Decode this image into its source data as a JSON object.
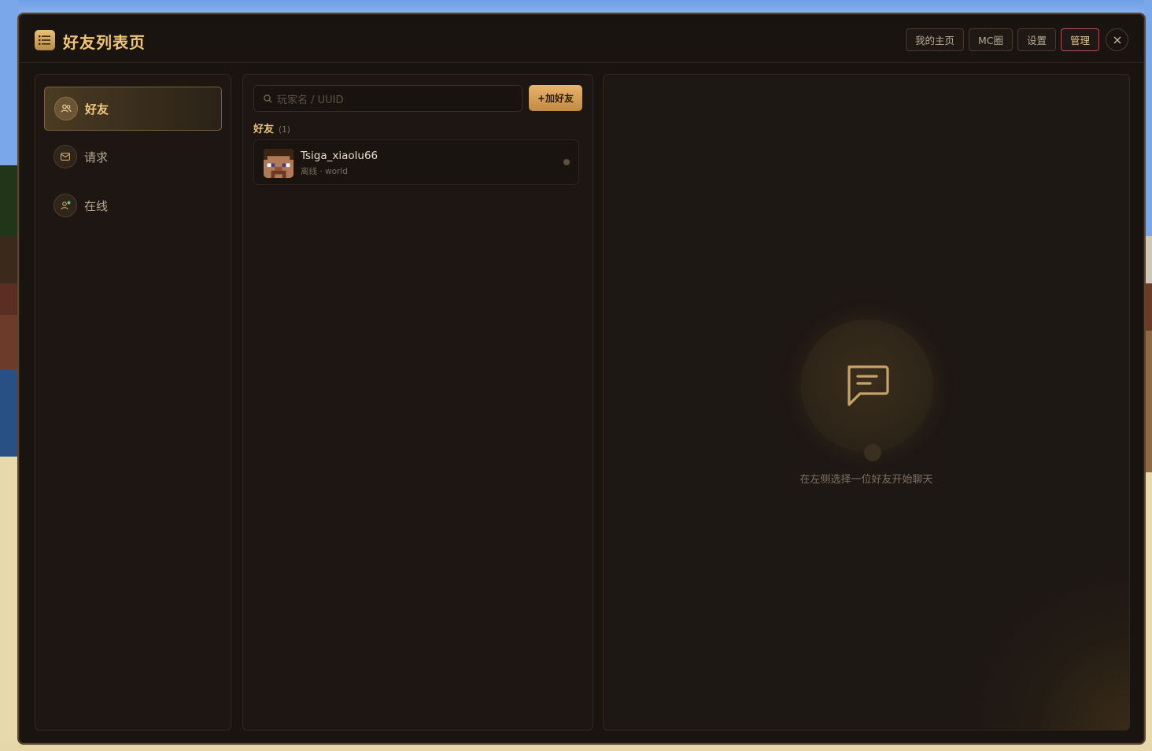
{
  "window": {
    "title": "好友列表页",
    "top_buttons": [
      {
        "label": "我的主页"
      },
      {
        "label": "MC圈"
      },
      {
        "label": "设置"
      },
      {
        "label": "管理"
      }
    ]
  },
  "sidebar": {
    "items": [
      {
        "label": "好友",
        "icon": "friends-icon",
        "active": true
      },
      {
        "label": "请求",
        "icon": "mail-icon",
        "active": false
      },
      {
        "label": "在线",
        "icon": "online-user-icon",
        "active": false
      }
    ]
  },
  "friends_panel": {
    "search_placeholder": "玩家名 / UUID",
    "add_button": "+加好友",
    "section_label": "好友",
    "section_count": "(1)",
    "friends": [
      {
        "name": "Tsiga_xiaolu66",
        "status": "离线 · world"
      }
    ]
  },
  "chat_panel": {
    "empty_text": "在左侧选择一位好友开始聊天"
  },
  "colors": {
    "accent": "#f0c675",
    "panel_bg": "#1d1612",
    "window_bg": "#1a1411",
    "admin_border": "#b0505a"
  }
}
